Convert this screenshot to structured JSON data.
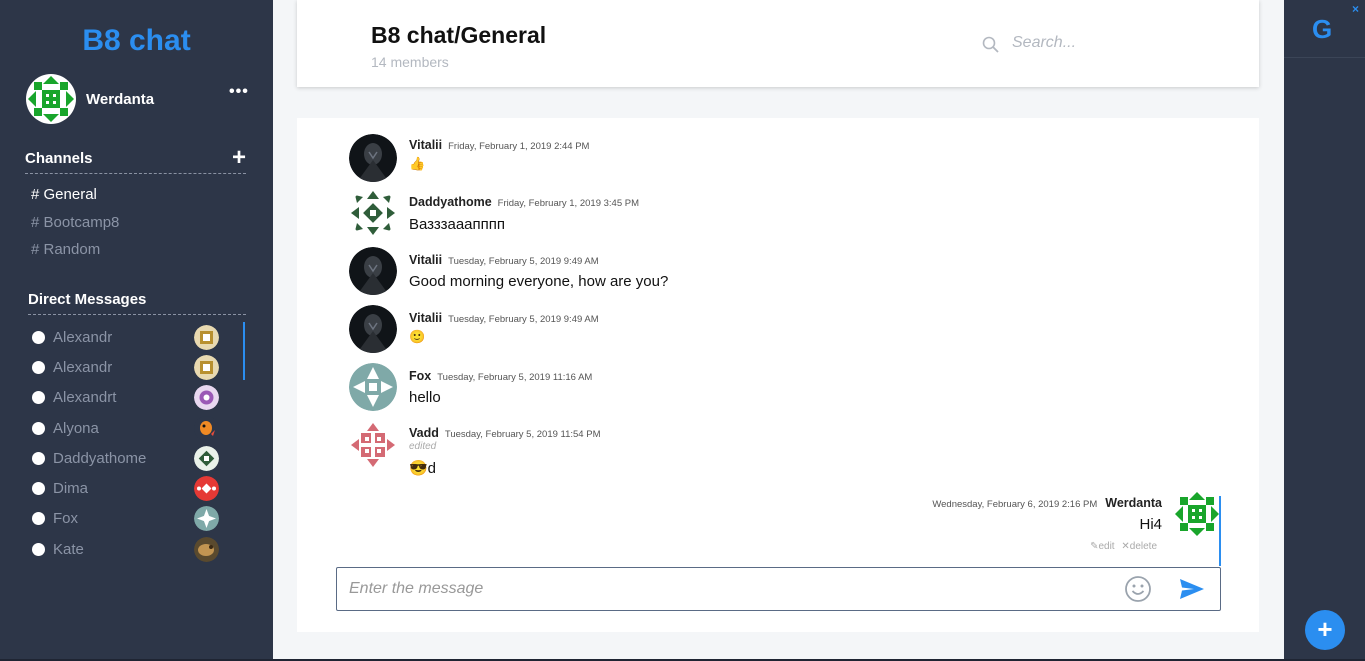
{
  "sidebar": {
    "brand": "B8 chat",
    "current_user": "Werdanta",
    "menu_glyph": "•••",
    "channels_title": "Channels",
    "add_glyph": "+",
    "channels": [
      {
        "label": "# General",
        "active": true
      },
      {
        "label": "# Bootcamp8",
        "active": false
      },
      {
        "label": "# Random",
        "active": false
      }
    ],
    "dm_title": "Direct Messages",
    "dms": [
      "Alexandr",
      "Alexandr",
      "Alexandrt",
      "Alyona",
      "Daddyathome",
      "Dima",
      "Fox",
      "Kate"
    ]
  },
  "header": {
    "title": "B8 chat/General",
    "members": "14 members",
    "search_placeholder": "Search..."
  },
  "messages": [
    {
      "author": "Vitalii",
      "time": "Friday, February 1, 2019 2:44 PM",
      "text": "👍"
    },
    {
      "author": "Daddyathome",
      "time": "Friday, February 1, 2019 3:45 PM",
      "text": "Вазззааапппп"
    },
    {
      "author": "Vitalii",
      "time": "Tuesday, February 5, 2019 9:49 AM",
      "text": "Good morning everyone, how are you?"
    },
    {
      "author": "Vitalii",
      "time": "Tuesday, February 5, 2019 9:49 AM",
      "text": "🙂"
    },
    {
      "author": "Fox",
      "time": "Tuesday, February 5, 2019 11:16 AM",
      "text": "hello"
    },
    {
      "author": "Vadd",
      "time": "Tuesday, February 5, 2019 11:54 PM",
      "edited": "edited",
      "text": "😎d"
    }
  ],
  "own_message": {
    "author": "Werdanta",
    "time": "Wednesday, February 6, 2019 2:16 PM",
    "text": "Hi4",
    "edit_label": "✎edit",
    "delete_label": "✕delete"
  },
  "composer": {
    "placeholder": "Enter the message"
  },
  "rail": {
    "logo": "G",
    "close": "×",
    "add": "+"
  },
  "colors": {
    "accent": "#2b8ef0",
    "sidebar_bg": "#2d3648"
  }
}
